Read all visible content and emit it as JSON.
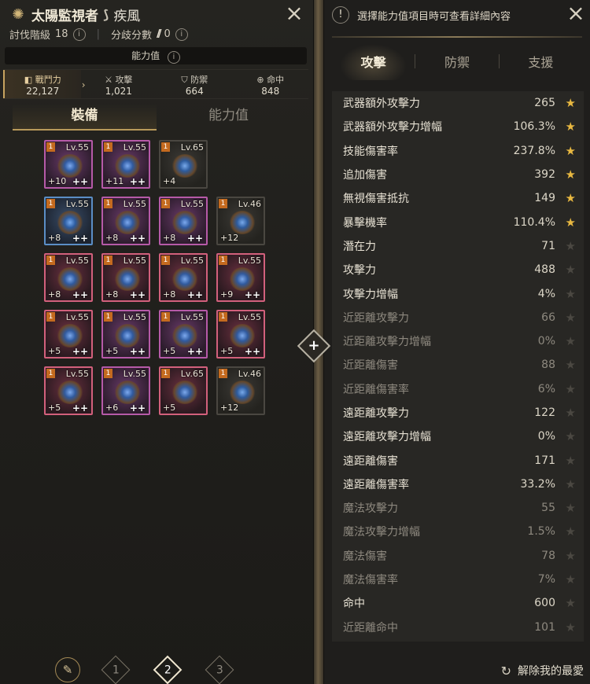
{
  "header": {
    "emblem_icon": "sun-emblem-icon",
    "title": "太陽監視者",
    "class_icon": "class-icon",
    "class_name": "疾風",
    "subjugation_label": "討伐階級",
    "subjugation_value": "18",
    "branch_label": "分歧分數",
    "branch_value": "0"
  },
  "ability_bar": "能力值",
  "stats": [
    {
      "label": "戰鬥力",
      "value": "22,127"
    },
    {
      "label": "攻擊",
      "value": "1,021"
    },
    {
      "label": "防禦",
      "value": "664"
    },
    {
      "label": "命中",
      "value": "848"
    }
  ],
  "left_tabs": [
    "裝備",
    "能力值"
  ],
  "gear": [
    {
      "level": "Lv.55",
      "plus": "+10",
      "pp": "++",
      "color": "purple",
      "badge": "1"
    },
    {
      "level": "Lv.55",
      "plus": "+11",
      "pp": "++",
      "color": "purple",
      "badge": "1"
    },
    {
      "level": "Lv.65",
      "plus": "+4",
      "pp": "",
      "color": "empty",
      "badge": "1"
    },
    {
      "level": "Lv.55",
      "plus": "+8",
      "pp": "++",
      "color": "blue",
      "badge": "1"
    },
    {
      "level": "Lv.55",
      "plus": "+8",
      "pp": "++",
      "color": "purple",
      "badge": "1"
    },
    {
      "level": "Lv.55",
      "plus": "+8",
      "pp": "++",
      "color": "purple",
      "badge": "1"
    },
    {
      "level": "Lv.46",
      "plus": "+12",
      "pp": "",
      "color": "empty",
      "badge": "1"
    },
    {
      "level": "Lv.55",
      "plus": "+8",
      "pp": "++",
      "color": "red",
      "badge": "1"
    },
    {
      "level": "Lv.55",
      "plus": "+8",
      "pp": "++",
      "color": "red",
      "badge": "1"
    },
    {
      "level": "Lv.55",
      "plus": "+8",
      "pp": "++",
      "color": "red",
      "badge": "1"
    },
    {
      "level": "Lv.55",
      "plus": "+9",
      "pp": "++",
      "color": "red",
      "badge": "1"
    },
    {
      "level": "Lv.55",
      "plus": "+5",
      "pp": "++",
      "color": "red",
      "badge": "1"
    },
    {
      "level": "Lv.55",
      "plus": "+5",
      "pp": "++",
      "color": "purple",
      "badge": "1"
    },
    {
      "level": "Lv.55",
      "plus": "+5",
      "pp": "++",
      "color": "purple",
      "badge": "1"
    },
    {
      "level": "Lv.55",
      "plus": "+5",
      "pp": "++",
      "color": "red",
      "badge": "1"
    },
    {
      "level": "Lv.55",
      "plus": "+5",
      "pp": "++",
      "color": "red",
      "badge": "1"
    },
    {
      "level": "Lv.55",
      "plus": "+6",
      "pp": "++",
      "color": "purple",
      "badge": "1"
    },
    {
      "level": "Lv.65",
      "plus": "+5",
      "pp": "",
      "color": "red",
      "badge": "1"
    },
    {
      "level": "Lv.46",
      "plus": "+12",
      "pp": "",
      "color": "empty",
      "badge": "1"
    }
  ],
  "pager": {
    "edit_icon": "edit-icon",
    "pages": [
      "1",
      "2",
      "3"
    ],
    "active": "2"
  },
  "right": {
    "hint": "選擇能力值項目時可查看詳細內容",
    "hint_icon": "warning-icon",
    "tabs": [
      "攻擊",
      "防禦",
      "支援"
    ],
    "stats": [
      {
        "name": "武器額外攻擊力",
        "value": "265",
        "fav": true,
        "dim": false
      },
      {
        "name": "武器額外攻擊力增幅",
        "value": "106.3%",
        "fav": true,
        "dim": false
      },
      {
        "name": "技能傷害率",
        "value": "237.8%",
        "fav": true,
        "dim": false
      },
      {
        "name": "追加傷害",
        "value": "392",
        "fav": true,
        "dim": false
      },
      {
        "name": "無視傷害抵抗",
        "value": "149",
        "fav": true,
        "dim": false
      },
      {
        "name": "暴擊機率",
        "value": "110.4%",
        "fav": true,
        "dim": false
      },
      {
        "name": "潛在力",
        "value": "71",
        "fav": false,
        "dim": false
      },
      {
        "name": "攻擊力",
        "value": "488",
        "fav": false,
        "dim": false
      },
      {
        "name": "攻擊力增幅",
        "value": "4%",
        "fav": false,
        "dim": false
      },
      {
        "name": "近距離攻擊力",
        "value": "66",
        "fav": false,
        "dim": true
      },
      {
        "name": "近距離攻擊力增幅",
        "value": "0%",
        "fav": false,
        "dim": true
      },
      {
        "name": "近距離傷害",
        "value": "88",
        "fav": false,
        "dim": true
      },
      {
        "name": "近距離傷害率",
        "value": "6%",
        "fav": false,
        "dim": true
      },
      {
        "name": "遠距離攻擊力",
        "value": "122",
        "fav": false,
        "dim": false
      },
      {
        "name": "遠距離攻擊力增幅",
        "value": "0%",
        "fav": false,
        "dim": false
      },
      {
        "name": "遠距離傷害",
        "value": "171",
        "fav": false,
        "dim": false
      },
      {
        "name": "遠距離傷害率",
        "value": "33.2%",
        "fav": false,
        "dim": false
      },
      {
        "name": "魔法攻擊力",
        "value": "55",
        "fav": false,
        "dim": true
      },
      {
        "name": "魔法攻擊力增幅",
        "value": "1.5%",
        "fav": false,
        "dim": true
      },
      {
        "name": "魔法傷害",
        "value": "78",
        "fav": false,
        "dim": true
      },
      {
        "name": "魔法傷害率",
        "value": "7%",
        "fav": false,
        "dim": true
      },
      {
        "name": "命中",
        "value": "600",
        "fav": false,
        "dim": false
      },
      {
        "name": "近距離命中",
        "value": "101",
        "fav": false,
        "dim": true
      }
    ],
    "remove_fav": "解除我的最愛"
  }
}
